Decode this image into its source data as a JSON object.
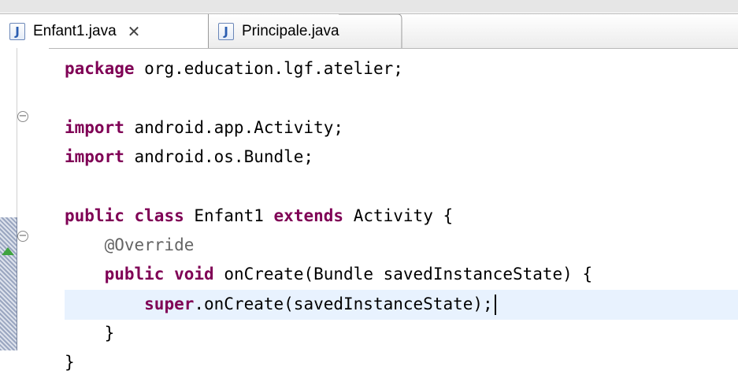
{
  "tabs": [
    {
      "label": "Enfant1.java",
      "active": true,
      "closable": true,
      "icon": "java-file-icon"
    },
    {
      "label": "Principale.java",
      "active": false,
      "closable": false,
      "icon": "java-file-icon"
    }
  ],
  "code": {
    "line1": {
      "kw": "package",
      "rest": " org.education.lgf.atelier;"
    },
    "line3": {
      "kw": "import",
      "rest": " android.app.Activity;"
    },
    "line4": {
      "kw": "import",
      "rest": " android.os.Bundle;"
    },
    "line6": {
      "kw1": "public",
      "kw2": "class",
      "mid": " Enfant1 ",
      "kw3": "extends",
      "rest": " Activity {"
    },
    "line7": {
      "annotation": "@Override"
    },
    "line8": {
      "kw1": "public",
      "kw2": "void",
      "rest": " onCreate(Bundle savedInstanceState) {"
    },
    "line9": {
      "kw": "super",
      "rest": ".onCreate(savedInstanceState);"
    },
    "line10": {
      "rest": "}"
    },
    "line11": {
      "rest": "}"
    }
  },
  "colors": {
    "keyword": "#7f0055",
    "annotation": "#646464",
    "current_line": "#e8f2fe"
  }
}
